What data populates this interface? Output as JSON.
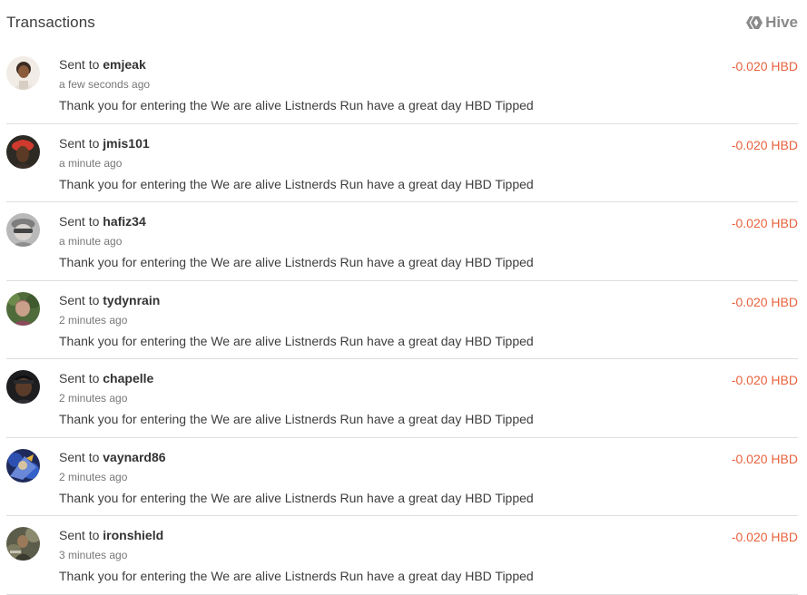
{
  "header": {
    "title": "Transactions",
    "brand_label": "Hive",
    "brand_icon": "hive-logo-icon"
  },
  "colors": {
    "amount": "#e8633e",
    "divider": "#dedede",
    "muted": "#777777"
  },
  "transactions": [
    {
      "prefix": "Sent to",
      "user": "emjeak",
      "time": "a few seconds ago",
      "memo": "Thank you for entering the We are alive Listnerds Run have a great day HBD Tipped",
      "amount": "-0.020 HBD"
    },
    {
      "prefix": "Sent to",
      "user": "jmis101",
      "time": "a minute ago",
      "memo": "Thank you for entering the We are alive Listnerds Run have a great day HBD Tipped",
      "amount": "-0.020 HBD"
    },
    {
      "prefix": "Sent to",
      "user": "hafiz34",
      "time": "a minute ago",
      "memo": "Thank you for entering the We are alive Listnerds Run have a great day HBD Tipped",
      "amount": "-0.020 HBD"
    },
    {
      "prefix": "Sent to",
      "user": "tydynrain",
      "time": "2 minutes ago",
      "memo": "Thank you for entering the We are alive Listnerds Run have a great day HBD Tipped",
      "amount": "-0.020 HBD"
    },
    {
      "prefix": "Sent to",
      "user": "chapelle",
      "time": "2 minutes ago",
      "memo": "Thank you for entering the We are alive Listnerds Run have a great day HBD Tipped",
      "amount": "-0.020 HBD"
    },
    {
      "prefix": "Sent to",
      "user": "vaynard86",
      "time": "2 minutes ago",
      "memo": "Thank you for entering the We are alive Listnerds Run have a great day HBD Tipped",
      "amount": "-0.020 HBD"
    },
    {
      "prefix": "Sent to",
      "user": "ironshield",
      "time": "3 minutes ago",
      "memo": "Thank you for entering the We are alive Listnerds Run have a great day HBD Tipped",
      "amount": "-0.020 HBD"
    }
  ]
}
